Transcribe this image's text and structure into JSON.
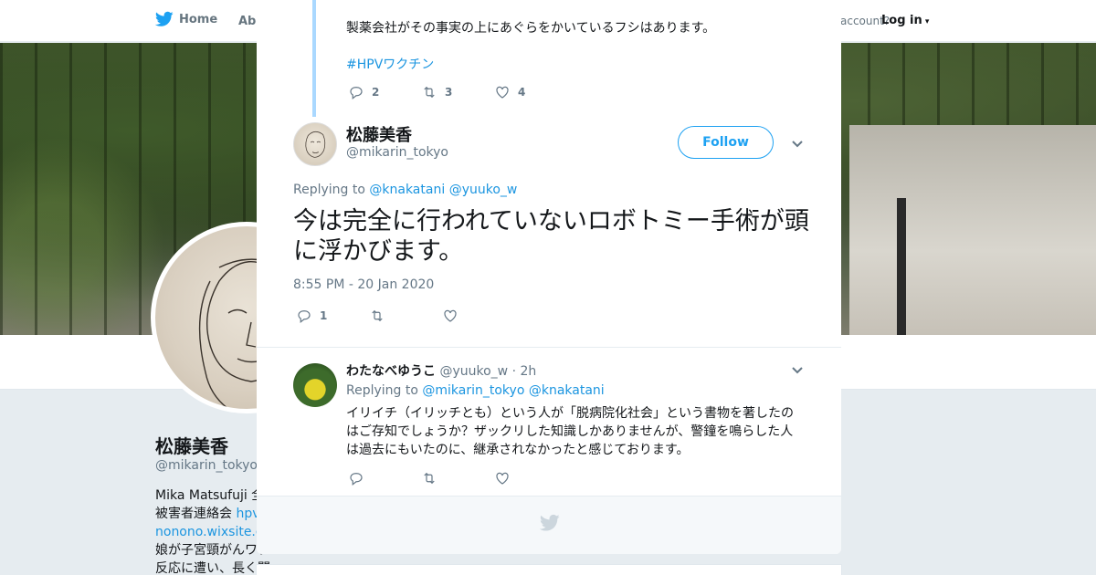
{
  "topbar": {
    "home_label": "Home",
    "about_label": "Abo",
    "account_prompt": "account?",
    "login_label": "Log in"
  },
  "background_profile": {
    "name": "松藤美香",
    "handle": "@mikarin_tokyo",
    "bio_line1": "Mika Matsufuji 全国",
    "bio_line2_prefix": "被害者連絡会 ",
    "bio_line2_link": "hpv",
    "bio_line3_link": "nonono.wixsite.co",
    "bio_line4": "娘が子宮頸がんワク",
    "bio_line5": "反応に遭い、長く闘"
  },
  "modal": {
    "close_icon": "close-icon",
    "previous_tweet": {
      "text": "製薬会社がその事実の上にあぐらをかいているフシはあります。",
      "hashtag": "#HPVワクチン",
      "reply_count": "2",
      "retweet_count": "3",
      "like_count": "4"
    },
    "main_tweet": {
      "author_name": "松藤美香",
      "author_handle": "@mikarin_tokyo",
      "follow_label": "Follow",
      "replying_prefix": "Replying to",
      "mention_1": "@knakatani",
      "mention_2": "@yuuko_w",
      "text": "今は完全に行われていないロボトミー手術が頭に浮かびます。",
      "timestamp": "8:55 PM - 20 Jan 2020",
      "reply_count": "1",
      "retweet_count": "",
      "like_count": ""
    },
    "reply_tweet": {
      "author_name": "わたなべゆうこ",
      "author_handle": "@yuuko_w",
      "separator": "·",
      "age": "2h",
      "replying_prefix": "Replying to",
      "mention_1": "@mikarin_tokyo",
      "mention_2": "@knakatani",
      "text": "イリイチ（イリッチとも）という人が「脱病院化社会」という書物を著したのはご存知でしょうか？ザックリした知識しかありませんが、警鐘を鳴らした人は過去にもいたのに、継承されなかったと感じております。"
    }
  },
  "colors": {
    "brand_blue": "#1da1f2",
    "link_blue": "#1b95e0",
    "muted_text": "#657786",
    "thread_line": "#aad8ff"
  }
}
